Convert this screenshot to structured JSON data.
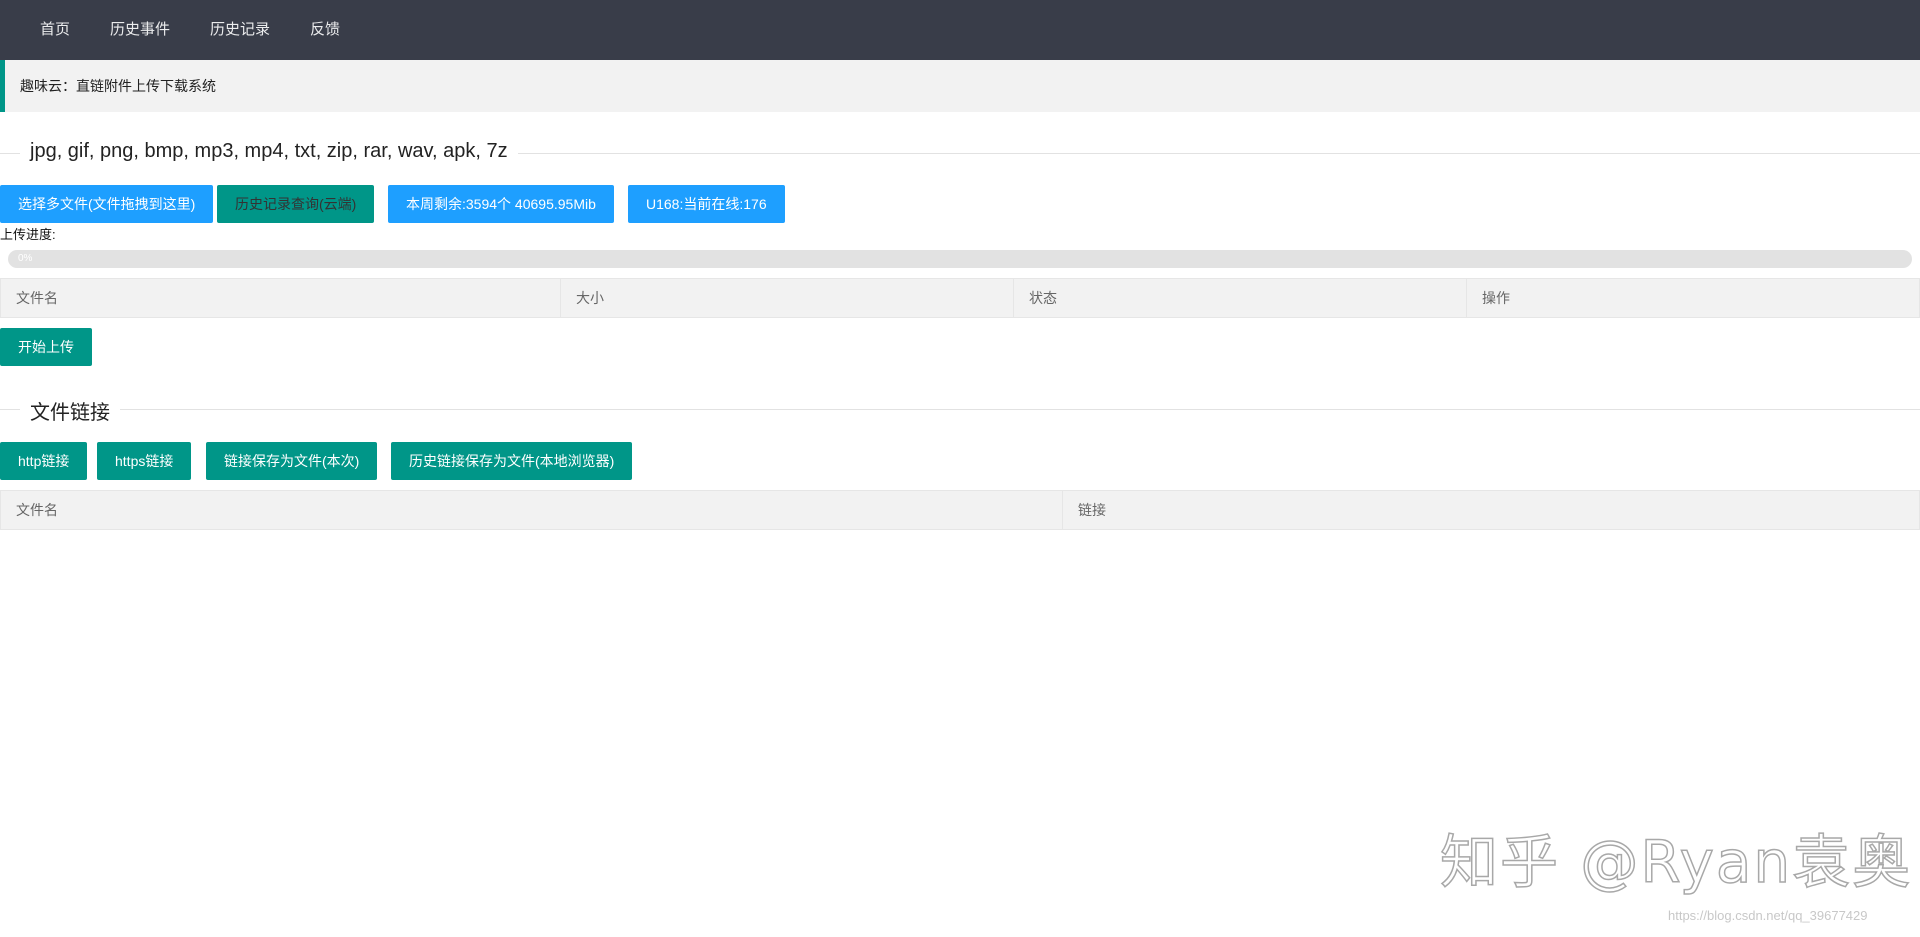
{
  "nav": {
    "items": [
      {
        "label": "首页"
      },
      {
        "label": "历史事件"
      },
      {
        "label": "历史记录"
      },
      {
        "label": "反馈"
      }
    ]
  },
  "banner": {
    "title": "趣味云：直链附件上传下载系统"
  },
  "upload_section": {
    "legend": "jpg, gif, png, bmp, mp3, mp4, txt, zip, rar, wav, apk, 7z",
    "buttons": {
      "select_files": "选择多文件(文件拖拽到这里)",
      "history_query": "历史记录查询(云端)",
      "weekly_remaining": "本周剩余:3594个 40695.95Mib",
      "online": "U168:当前在线:176"
    },
    "progress_label": "上传进度:",
    "progress": {
      "value": 0,
      "text": "0%"
    },
    "table_headers": [
      "文件名",
      "大小",
      "状态",
      "操作"
    ],
    "start_upload": "开始上传"
  },
  "links_section": {
    "legend": "文件链接",
    "buttons": {
      "http": "http链接",
      "https": "https链接",
      "save_current": "链接保存为文件(本次)",
      "save_history": "历史链接保存为文件(本地浏览器)"
    },
    "table_headers": [
      "文件名",
      "链接"
    ]
  },
  "watermark": {
    "main": "知乎 @Ryan袁奥",
    "url": "https://blog.csdn.net/qq_39677429"
  },
  "colors": {
    "nav_bg": "#393d49",
    "accent_green": "#009688",
    "accent_blue": "#1e9fff",
    "table_header_bg": "#f2f2f2"
  }
}
